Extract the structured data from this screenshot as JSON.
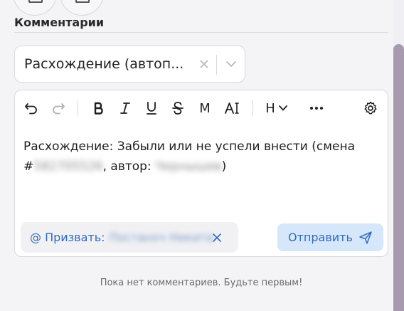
{
  "section": {
    "title": "Комментарии"
  },
  "top_buttons": [
    {
      "icon": "document-icon"
    },
    {
      "icon": "document-icon"
    }
  ],
  "select": {
    "value": "Расхождение (автоп..."
  },
  "toolbar": {
    "markdown_label": "M",
    "heading_label": "H"
  },
  "editor": {
    "line1": "Расхождение: Забыли или не успели внести (смена",
    "hash": "#",
    "shift_number": "582705526",
    "author_prefix": ", автор: ",
    "author_name": "Чернышев",
    "closing": ")"
  },
  "mention": {
    "label": "@ Призвать:",
    "name": "Постаноч Никита"
  },
  "send": {
    "label": "Отправить"
  },
  "empty_state": {
    "text": "Пока нет комментариев. Будьте первым!"
  },
  "colors": {
    "accent": "#2f6bc4",
    "send_bg": "#d6e7fb",
    "scroll_thumb": "#a89aae"
  }
}
